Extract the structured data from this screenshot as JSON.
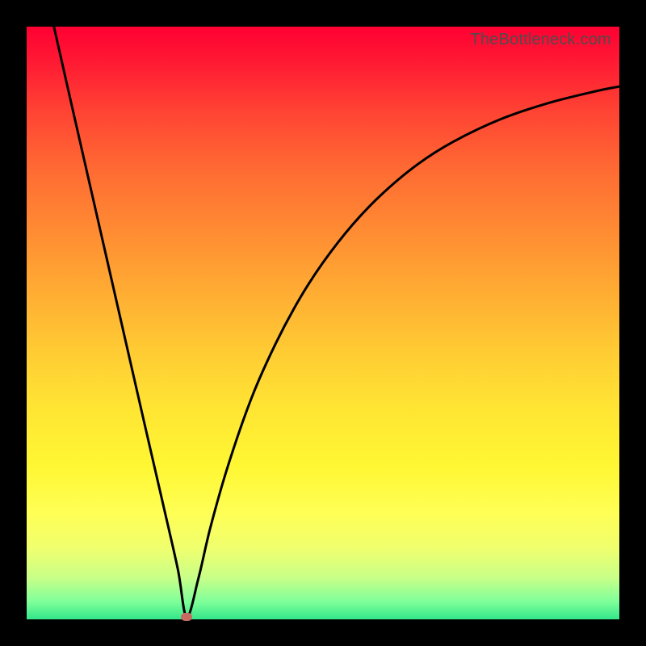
{
  "watermark_text": "TheBottleneck.com",
  "chart_data": {
    "type": "line",
    "title": "",
    "xlabel": "",
    "ylabel": "",
    "xlim": [
      0,
      100
    ],
    "ylim": [
      0,
      100
    ],
    "grid": false,
    "series": [
      {
        "name": "bottleneck-curve",
        "x": [
          4.6,
          8,
          12,
          16,
          20,
          23,
          25.5,
          27,
          29,
          31,
          34,
          38,
          42,
          46,
          50,
          55,
          60,
          66,
          72,
          80,
          88,
          96,
          100
        ],
        "values": [
          100,
          85,
          67.5,
          50,
          32.5,
          19.5,
          8.5,
          0.4,
          7,
          15.5,
          26,
          37.5,
          46.5,
          54,
          60.2,
          66.6,
          71.8,
          76.8,
          80.6,
          84.4,
          87.1,
          89.1,
          89.9
        ]
      }
    ],
    "min_marker": {
      "x": 27,
      "y": 0.4
    },
    "background_gradient": {
      "top_color": "#ff0033",
      "bottom_color": "#33e68a",
      "meaning": "red-high to green-low"
    }
  }
}
